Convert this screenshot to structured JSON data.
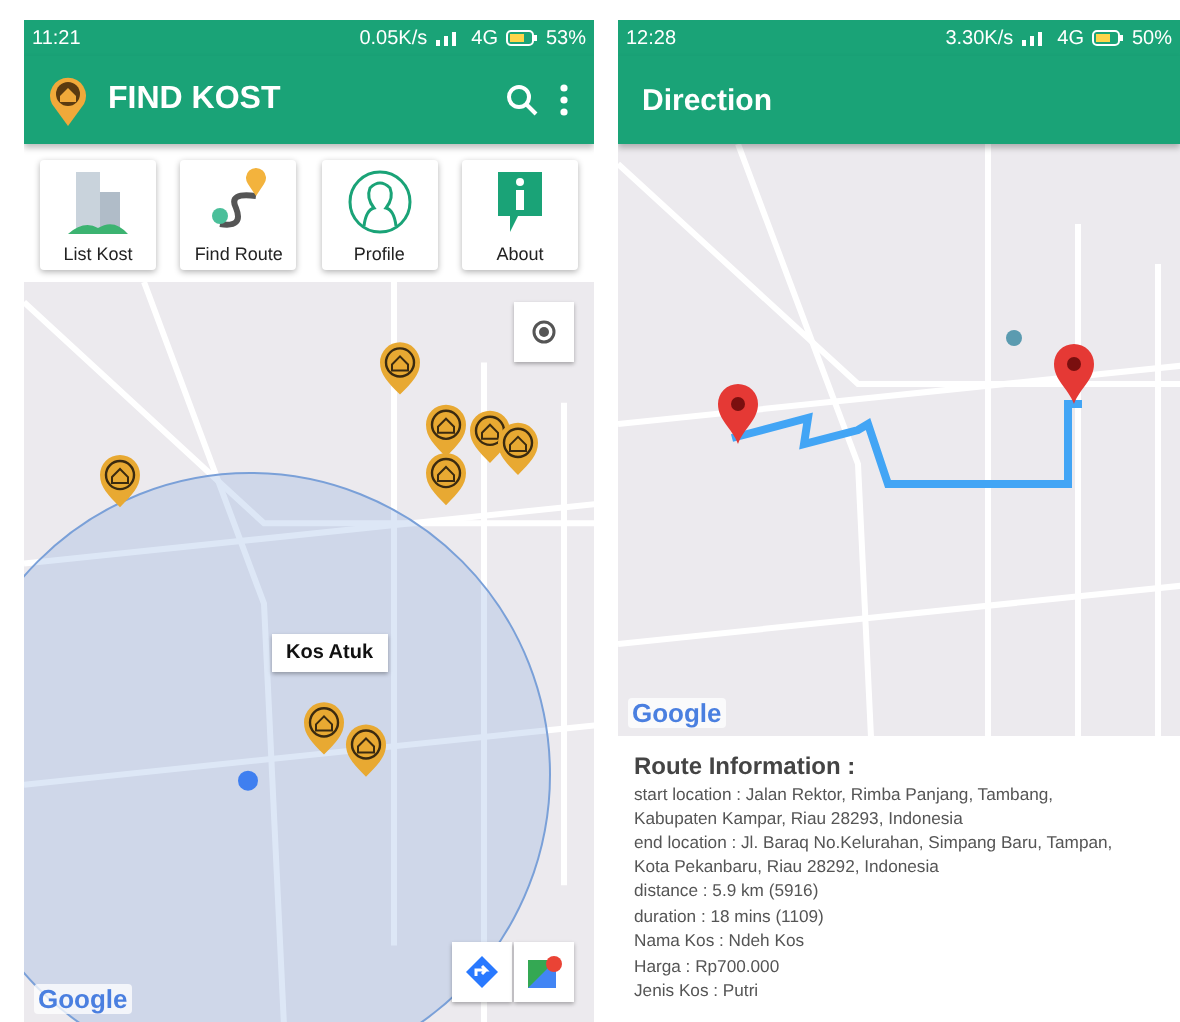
{
  "screens": [
    {
      "kind": "home",
      "status_bar": {
        "time": "11:21",
        "speed": "0.05K/s",
        "network": "4G",
        "battery": "53%"
      },
      "app_bar": {
        "title": "FIND KOST"
      },
      "menu": [
        {
          "label": "List Kost"
        },
        {
          "label": "Find Route"
        },
        {
          "label": "Profile"
        },
        {
          "label": "About"
        }
      ],
      "map": {
        "info_window": "Kos Atuk",
        "attribution": "Google"
      }
    },
    {
      "kind": "direction",
      "status_bar": {
        "time": "12:28",
        "speed": "3.30K/s",
        "network": "4G",
        "battery": "50%"
      },
      "app_bar": {
        "title": "Direction"
      },
      "map": {
        "attribution": "Google"
      },
      "route_info": {
        "heading": "Route Information :",
        "lines": [
          "start location : Jalan Rektor, Rimba Panjang, Tambang, Kabupaten Kampar, Riau 28293, Indonesia",
          "end location : Jl. Baraq No.Kelurahan, Simpang Baru, Tampan, Kota Pekanbaru, Riau 28292, Indonesia",
          "distance : 5.9 km (5916)",
          "duration : 18 mins (1109)",
          "Nama Kos : Ndeh Kos",
          "Harga : Rp700.000",
          "Jenis Kos : Putri"
        ]
      }
    }
  ]
}
